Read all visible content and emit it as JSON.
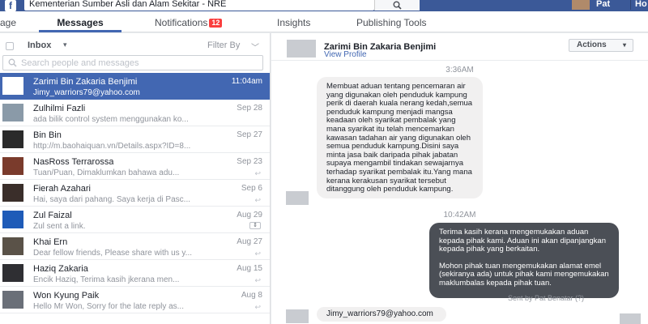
{
  "topbar": {
    "logo": "f",
    "page_name": "Kementerian Sumber Asli dan Alam Sekitar - NRE",
    "user_name": "Pat",
    "home_label": "Ho"
  },
  "nav": {
    "tabs": [
      {
        "label": "Page"
      },
      {
        "label": "Messages"
      },
      {
        "label": "Notifications"
      },
      {
        "label": "Insights"
      },
      {
        "label": "Publishing Tools"
      }
    ],
    "notification_count": "12",
    "active_tab": "Messages"
  },
  "inbox": {
    "folder": "Inbox",
    "caret": "▾",
    "filter_label": "Filter By",
    "filter_caret": "﹀",
    "search_placeholder": "Search people and messages"
  },
  "conversations": [
    {
      "name": "Zarimi Bin Zakaria Benjimi",
      "time": "11:04am",
      "snippet": "Jimy_warriors79@yahoo.com",
      "reply": ""
    },
    {
      "name": "Zulhilmi Fazli",
      "time": "Sep 28",
      "snippet": "ada bilik control system menggunakan ko...",
      "reply": ""
    },
    {
      "name": "Bin Bin",
      "time": "Sep 27",
      "snippet": "http://m.baohaiquan.vn/Details.aspx?ID=8...",
      "reply": ""
    },
    {
      "name": "NasRoss Terrarossa",
      "time": "Sep 23",
      "snippet": "Tuan/Puan, Dimaklumkan bahawa adu...",
      "reply": "↩"
    },
    {
      "name": "Fierah Azahari",
      "time": "Sep 6",
      "snippet": "Hai, saya dari pahang. Saya kerja di Pasc...",
      "reply": "↩"
    },
    {
      "name": "Zul Faizal",
      "time": "Aug 29",
      "snippet": "Zul sent a link.",
      "reply": ""
    },
    {
      "name": "Khai Ern",
      "time": "Aug 27",
      "snippet": "Dear fellow friends, Please share with us y...",
      "reply": "↩"
    },
    {
      "name": "Haziq Zakaria",
      "time": "Aug 15",
      "snippet": "Encik Haziq, Terima kasih jkerana men...",
      "reply": "↩"
    },
    {
      "name": "Won Kyung Paik",
      "time": "Aug 8",
      "snippet": "Hello Mr Won, Sorry for the late reply as...",
      "reply": "↩"
    }
  ],
  "thread": {
    "name": "Zarimi Bin Zakaria Benjimi",
    "profile_link": "View Profile",
    "actions_label": "Actions",
    "actions_caret": "▾",
    "time_1": "3:36AM",
    "incoming_message": "Membuat aduan tentang pencemaran air yang digunakan oleh penduduk kampung perik di daerah kuala nerang kedah,semua penduduk kampung menjadi mangsa keadaan oleh syarikat pembalak yang mana syarikat itu telah mencemarkan kawasan tadahan air yang digunakan oleh semua penduduk kampung.Disini saya minta jasa baik daripada pihak jabatan supaya mengambil tindakan sewajarnya terhadap syarikat pembalak itu.Yang mana kerana kerakusan syarikat tersebut ditanggung oleh penduduk kampung.",
    "time_2": "10:42AM",
    "outgoing_para_1": "Terima kasih kerana mengemukakan aduan kepada pihak kami. Aduan ini akan dipanjangkan kepada pihak yang berkaitan.",
    "outgoing_para_2": "Mohon pihak tuan mengemukakan alamat emel (sekiranya ada) untuk pihak kami mengemukakan maklumbalas kepada pihak tuan.",
    "sent_by": "Sent by Pat Benatar (?)",
    "last_message": "Jimy_warriors79@yahoo.com"
  },
  "colors": {
    "brand": "#3b5998",
    "selected": "#4267b2",
    "badge": "#fa3e3e",
    "outgoing_bubble": "#4b4f56"
  }
}
